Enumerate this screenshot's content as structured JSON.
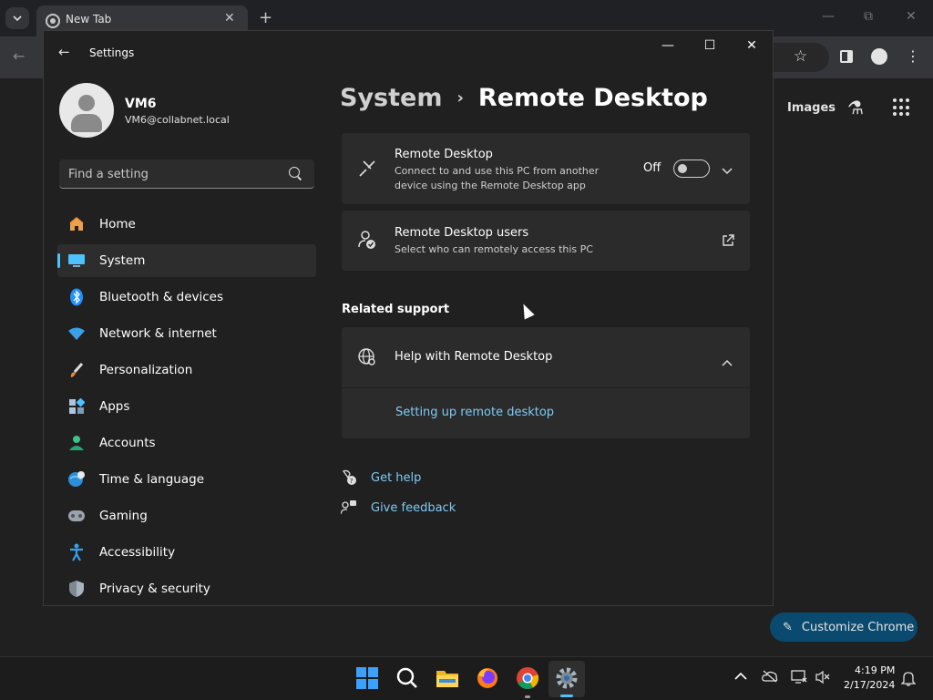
{
  "chrome": {
    "tab_title": "New Tab",
    "images_link": "Images",
    "customize_label": "Customize Chrome",
    "minimize": "—",
    "restore": "⧉",
    "close": "✕"
  },
  "settings": {
    "window_title": "Settings",
    "minimize": "—",
    "maximize": "☐",
    "close": "✕",
    "user": {
      "name": "VM6",
      "email": "VM6@collabnet.local"
    },
    "search": {
      "placeholder": "Find a setting"
    },
    "nav": [
      {
        "label": "Home",
        "icon": "home-icon"
      },
      {
        "label": "System",
        "icon": "system-icon",
        "active": true
      },
      {
        "label": "Bluetooth & devices",
        "icon": "bluetooth-icon"
      },
      {
        "label": "Network & internet",
        "icon": "network-icon"
      },
      {
        "label": "Personalization",
        "icon": "brush-icon"
      },
      {
        "label": "Apps",
        "icon": "apps-icon"
      },
      {
        "label": "Accounts",
        "icon": "accounts-icon"
      },
      {
        "label": "Time & language",
        "icon": "globe-clock-icon"
      },
      {
        "label": "Gaming",
        "icon": "gamepad-icon"
      },
      {
        "label": "Accessibility",
        "icon": "accessibility-icon"
      },
      {
        "label": "Privacy & security",
        "icon": "shield-icon"
      }
    ],
    "breadcrumb": {
      "parent": "System",
      "separator": "›",
      "current": "Remote Desktop"
    },
    "remote_desktop": {
      "title": "Remote Desktop",
      "description": "Connect to and use this PC from another device using the Remote Desktop app",
      "toggle_label": "Off"
    },
    "remote_users": {
      "title": "Remote Desktop users",
      "description": "Select who can remotely access this PC"
    },
    "related_support": {
      "heading": "Related support",
      "help_title": "Help with Remote Desktop",
      "help_link": "Setting up remote desktop"
    },
    "footer_links": {
      "get_help": "Get help",
      "give_feedback": "Give feedback"
    }
  },
  "taskbar": {
    "time": "4:19 PM",
    "date": "2/17/2024"
  },
  "colors": {
    "accent": "#4cc2ff",
    "link": "#7ecbf5",
    "card": "#2b2b2b",
    "window": "#202020"
  }
}
